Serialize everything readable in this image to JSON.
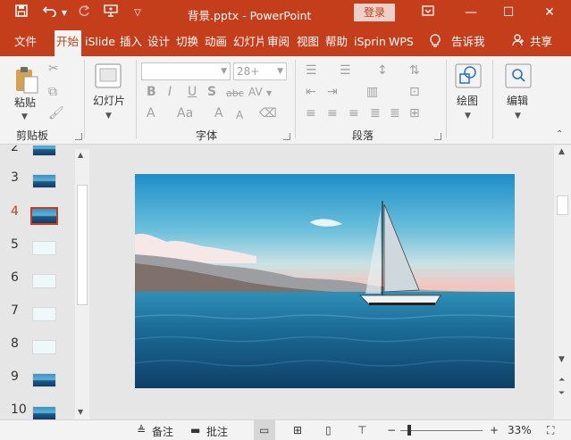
{
  "titlebar": {
    "doc_title": "背景.pptx  -  PowerPoint",
    "login_label": "登录",
    "icons": [
      "save-icon",
      "undo-icon",
      "redo-icon",
      "present-icon",
      "customize-qat-icon"
    ],
    "window_controls": [
      "ribbon-display-icon",
      "minimize-icon",
      "maximize-icon",
      "close-icon"
    ]
  },
  "tabs": [
    "文件",
    "开始",
    "iSlide",
    "插入",
    "设计",
    "切换",
    "动画",
    "幻灯片",
    "审阅",
    "视图",
    "帮助",
    "iSprin",
    "WPS"
  ],
  "active_tab": "开始",
  "tell_me": "告诉我",
  "share": "共享",
  "ribbon": {
    "clipboard": {
      "paste_label": "粘贴",
      "group_label": "剪贴板"
    },
    "slides": {
      "new_slide_label": "幻灯片",
      "group_label": ""
    },
    "font": {
      "font_size": "28+",
      "group_label": "字体",
      "bold": "B",
      "italic": "I",
      "underline": "U",
      "shadow": "S",
      "strike": "abc",
      "spacing": "AV",
      "case": "Aa",
      "grow": "A",
      "shrink": "A",
      "color": "A"
    },
    "paragraph": {
      "group_label": "段落"
    },
    "drawing": {
      "label": "绘图"
    },
    "editing": {
      "label": "编辑"
    }
  },
  "slide_numbers": [
    "2",
    "3",
    "4",
    "5",
    "6",
    "7",
    "8",
    "9",
    "10"
  ],
  "active_slide": "4",
  "statusbar": {
    "notes_label": "备注",
    "comments_label": "批注",
    "zoom_minus": "−",
    "zoom_plus": "+",
    "zoom_level": "33%"
  },
  "colors": {
    "accent": "#c43e1c",
    "ribbon_bg": "#f3f3f3",
    "workspace_bg": "#e6e6e6"
  }
}
